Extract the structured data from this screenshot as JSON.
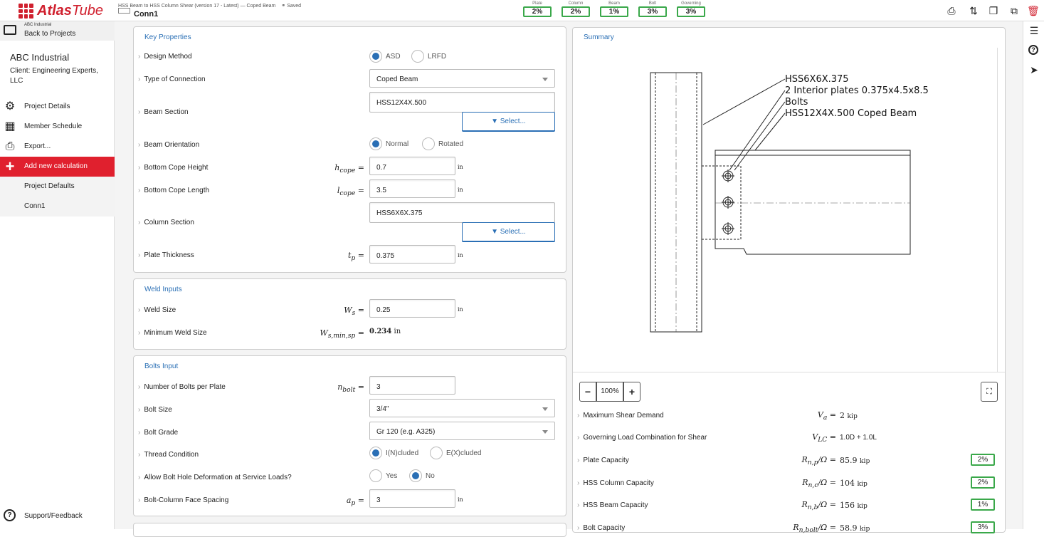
{
  "app": {
    "logo_main": "Atlas",
    "logo_sub": "Tube"
  },
  "header": {
    "breadcrumb": "HSS Beam to HSS Column Shear (version 17 - Latest) — Coped Beam",
    "saved": "Saved",
    "conn_name": "Conn1",
    "utilization": [
      {
        "label": "Plate",
        "value": "2%"
      },
      {
        "label": "Column",
        "value": "2%"
      },
      {
        "label": "Beam",
        "value": "1%"
      },
      {
        "label": "Bolt",
        "value": "3%"
      },
      {
        "label": "Governing",
        "value": "3%"
      }
    ],
    "icons": [
      "print-icon",
      "swap-icon",
      "copy-icon",
      "share-icon",
      "delete-icon"
    ]
  },
  "sidebar": {
    "back_small": "ABC Industrial",
    "back_label": "Back to Projects",
    "company": "ABC Industrial",
    "client": "Client: Engineering Experts, LLC",
    "items": [
      {
        "label": "Project Details"
      },
      {
        "label": "Member Schedule"
      },
      {
        "label": "Export..."
      },
      {
        "label": "Add new calculation"
      },
      {
        "label": "Project Defaults"
      },
      {
        "label": "Conn1"
      }
    ],
    "support": "Support/Feedback"
  },
  "key": {
    "title": "Key Properties",
    "design_method": {
      "label": "Design Method",
      "opt1": "ASD",
      "opt2": "LRFD"
    },
    "connection_type": {
      "label": "Type of Connection",
      "value": "Coped Beam"
    },
    "beam_section": {
      "label": "Beam Section",
      "value": "HSS12X4X.500",
      "button": "Select..."
    },
    "beam_orientation": {
      "label": "Beam Orientation",
      "opt1": "Normal",
      "opt2": "Rotated"
    },
    "cope_height": {
      "label": "Bottom Cope Height",
      "sym": "h",
      "sub": "cope",
      "value": "0.7",
      "unit": "in"
    },
    "cope_length": {
      "label": "Bottom Cope Length",
      "sym": "l",
      "sub": "cope",
      "value": "3.5",
      "unit": "in"
    },
    "column_section": {
      "label": "Column Section",
      "value": "HSS6X6X.375",
      "button": "Select..."
    },
    "plate_thickness": {
      "label": "Plate Thickness",
      "sym": "t",
      "sub": "p",
      "value": "0.375",
      "unit": "in"
    }
  },
  "weld": {
    "title": "Weld Inputs",
    "size": {
      "label": "Weld Size",
      "sym": "W",
      "sub": "s",
      "value": "0.25",
      "unit": "in"
    },
    "min": {
      "label": "Minimum Weld Size",
      "sym": "W",
      "sub": "s,min,sp",
      "value": "0.234",
      "unit": "in"
    }
  },
  "bolts": {
    "title": "Bolts Input",
    "count": {
      "label": "Number of Bolts per Plate",
      "sym": "n",
      "sub": "bolt",
      "value": "3"
    },
    "size": {
      "label": "Bolt Size",
      "value": "3/4\""
    },
    "grade": {
      "label": "Bolt Grade",
      "value": "Gr 120 (e.g. A325)"
    },
    "thread": {
      "label": "Thread Condition",
      "opt1": "I(N)cluded",
      "opt2": "E(X)cluded"
    },
    "deform": {
      "label": "Allow Bolt Hole Deformation at Service Loads?",
      "opt1": "Yes",
      "opt2": "No"
    },
    "spacing": {
      "label": "Bolt-Column Face Spacing",
      "sym": "a",
      "sub": "p",
      "value": "3",
      "unit": "in"
    }
  },
  "summary": {
    "title": "Summary",
    "callouts": [
      "HSS6X6X.375",
      "2 Interior plates 0.375x4.5x8.5",
      "Bolts",
      "HSS12X4X.500 Coped Beam"
    ],
    "zoom": "100%",
    "zoom_minus": "−",
    "zoom_plus": "+",
    "results": [
      {
        "label": "Maximum Shear Demand",
        "sym": "V",
        "sub": "a",
        "value": "2",
        "unit": "kip",
        "pct": ""
      },
      {
        "label": "Governing Load Combination for Shear",
        "sym": "V",
        "sub": "LC",
        "value": "1.0D + 1.0L",
        "unit": "",
        "pct": ""
      },
      {
        "label": "Plate Capacity",
        "sym": "R",
        "sub": "n,p",
        "value": "85.9",
        "unit": "kip",
        "pct": "2%"
      },
      {
        "label": "HSS Column Capacity",
        "sym": "R",
        "sub": "n,c",
        "value": "104",
        "unit": "kip",
        "pct": "2%"
      },
      {
        "label": "HSS Beam Capacity",
        "sym": "R",
        "sub": "n,b",
        "value": "156",
        "unit": "kip",
        "pct": "1%"
      },
      {
        "label": "Bolt Capacity",
        "sym": "R",
        "sub": "n,bolt",
        "value": "58.9",
        "unit": "kip",
        "pct": "3%"
      }
    ]
  },
  "colors": {
    "brand": "#d0202e",
    "accent": "#2a6fb5",
    "ok": "#3aa84a"
  }
}
